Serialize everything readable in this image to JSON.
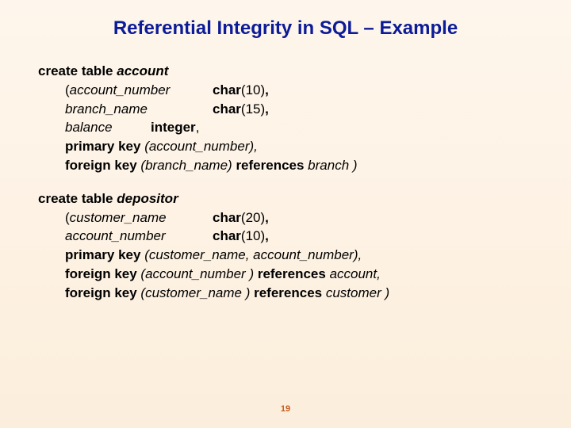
{
  "title": "Referential Integrity in SQL – Example",
  "block1": {
    "l0a": "create table ",
    "l0b": "account",
    "l1a": "(",
    "l1b": "account_number",
    "l1c": "char",
    "l1d": "(10)",
    "l1e": ",",
    "l2a": "branch_name",
    "l2b": "char",
    "l2c": "(15)",
    "l2d": ",",
    "l3a": "balance",
    "l3b": "integer",
    "l3c": ",",
    "l4a": "primary key ",
    "l4b": "(account_number),",
    "l5a": "foreign key ",
    "l5b": "(branch_name) ",
    "l5c": "references ",
    "l5d": "branch )"
  },
  "block2": {
    "l0a": "create table ",
    "l0b": "depositor",
    "l1a": "(",
    "l1b": "customer_name",
    "l1c": "char",
    "l1d": "(20)",
    "l1e": ",",
    "l2a": "account_number",
    "l2b": "char",
    "l2c": "(10)",
    "l2d": ",",
    "l3a": "primary key ",
    "l3b": "(customer_name, account_number),",
    "l4a": "foreign key ",
    "l4b": "(account_number ) ",
    "l4c": "references ",
    "l4d": "account,",
    "l5a": "foreign key ",
    "l5b": "(customer_name ) ",
    "l5c": "references ",
    "l5d": "customer )"
  },
  "page_number": "19"
}
